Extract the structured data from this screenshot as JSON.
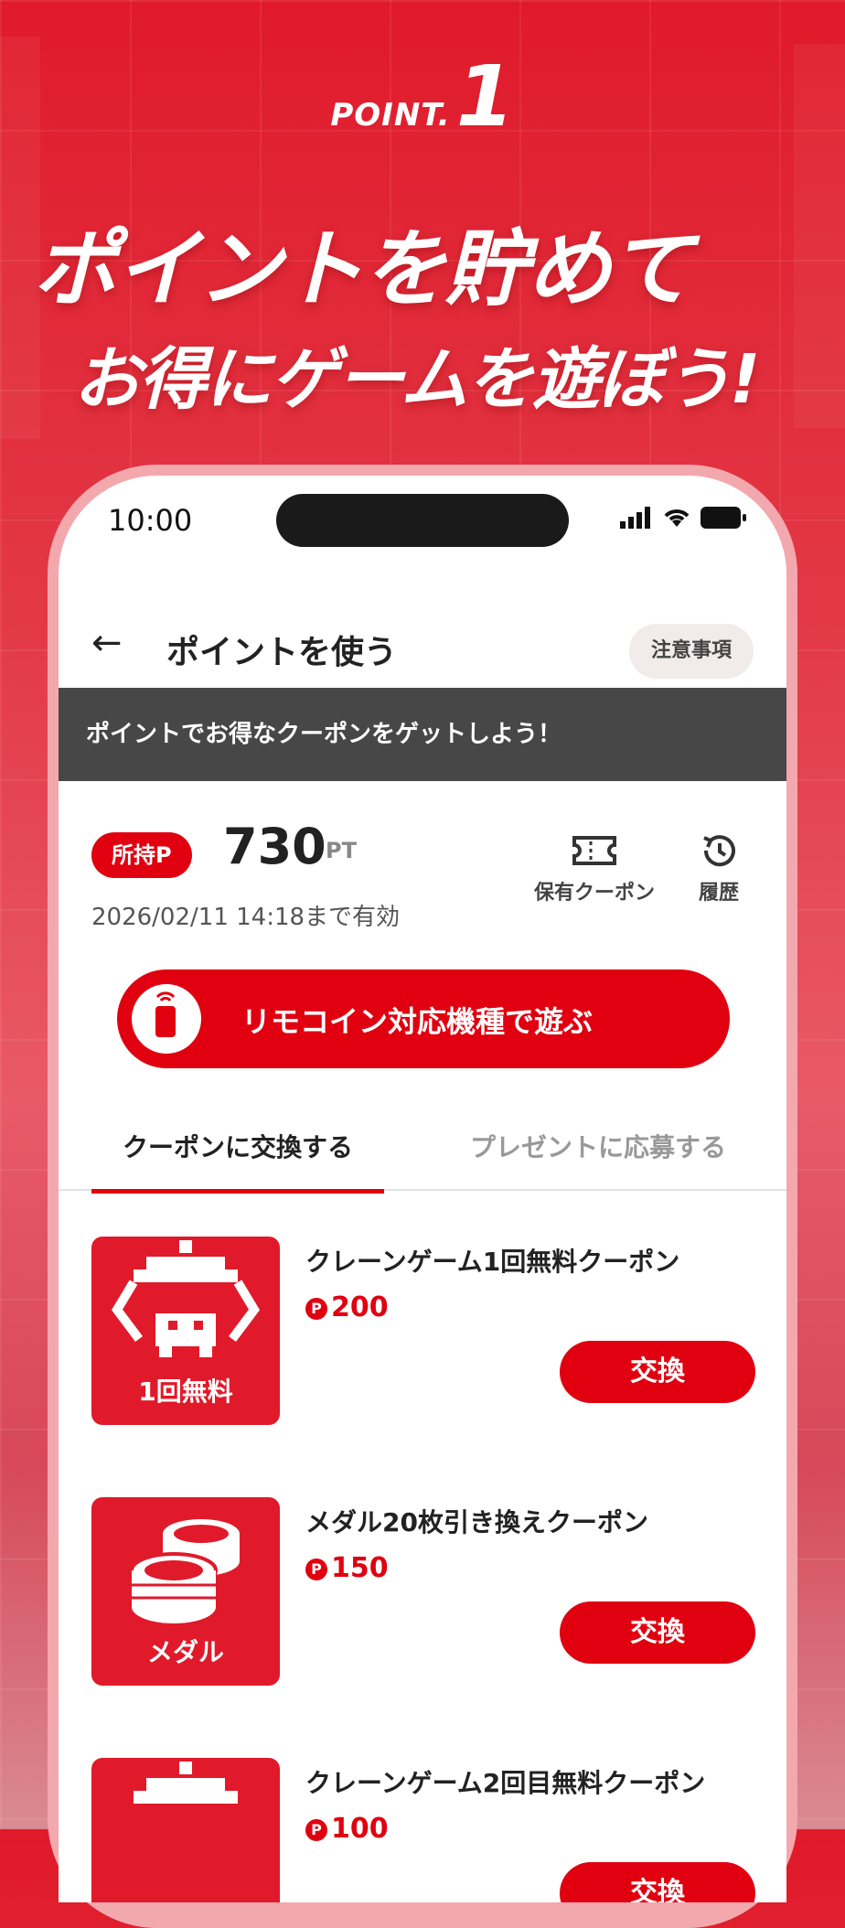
{
  "promo": {
    "point_prefix": "POINT.",
    "point_number": "1",
    "headline_line1": "ポイントを貯めて",
    "headline_line2": "お得にゲームを遊ぼう!"
  },
  "status_bar": {
    "time": "10:00"
  },
  "header": {
    "title": "ポイントを使う",
    "notice_button": "注意事項"
  },
  "banner": {
    "text": "ポイントでお得なクーポンをゲットしよう！"
  },
  "points": {
    "badge": "所持P",
    "value": "730",
    "unit": "PT",
    "expiry": "2026/02/11 14:18まで有効",
    "coupon_label": "保有クーポン",
    "history_label": "履歴"
  },
  "play_button": {
    "label": "リモコイン対応機種で遊ぶ"
  },
  "tabs": [
    {
      "label": "クーポンに交換する",
      "active": true
    },
    {
      "label": "プレゼントに応募する",
      "active": false
    }
  ],
  "coupons": [
    {
      "name": "クレーンゲーム1回無料クーポン",
      "thumb_label": "1回無料",
      "price": "200",
      "button": "交換"
    },
    {
      "name": "メダル20枚引き換えクーポン",
      "thumb_label": "メダル",
      "price": "150",
      "button": "交換"
    },
    {
      "name": "クレーンゲーム2回目無料クーポン",
      "thumb_label": "",
      "price": "100",
      "button": "交換"
    }
  ],
  "colors": {
    "accent": "#e00010",
    "banner_bg": "#474747",
    "background": "#e01a2a"
  }
}
